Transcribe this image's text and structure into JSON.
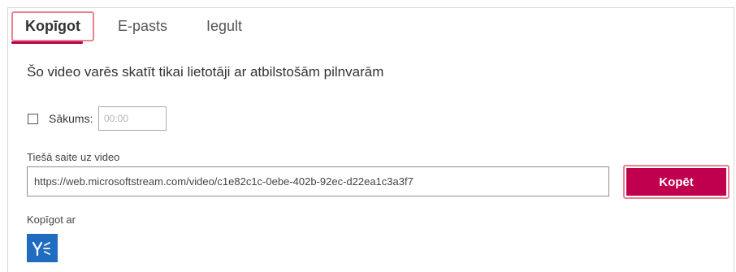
{
  "tabs": [
    {
      "label": "Kopīgot",
      "active": true
    },
    {
      "label": "E-pasts",
      "active": false
    },
    {
      "label": "Iegult",
      "active": false
    }
  ],
  "headline": "Šo video varēs skatīt tikai lietotāji ar atbilstošām pilnvarām",
  "start": {
    "label": "Sākums:",
    "checked": false,
    "placeholder": "00:00"
  },
  "direct_link": {
    "label": "Tiešā saite uz video",
    "value": "https://web.microsoftstream.com/video/c1e82c1c-0ebe-402b-92ec-d22ea1c3a3f7"
  },
  "copy_button": {
    "label": "Kopēt"
  },
  "share_with": {
    "label": "Kopīgot ar",
    "icons": [
      "yammer-icon"
    ]
  },
  "colors": {
    "accent": "#c0004f",
    "highlight_border": "#e8828f",
    "yammer": "#1f6cc0"
  }
}
